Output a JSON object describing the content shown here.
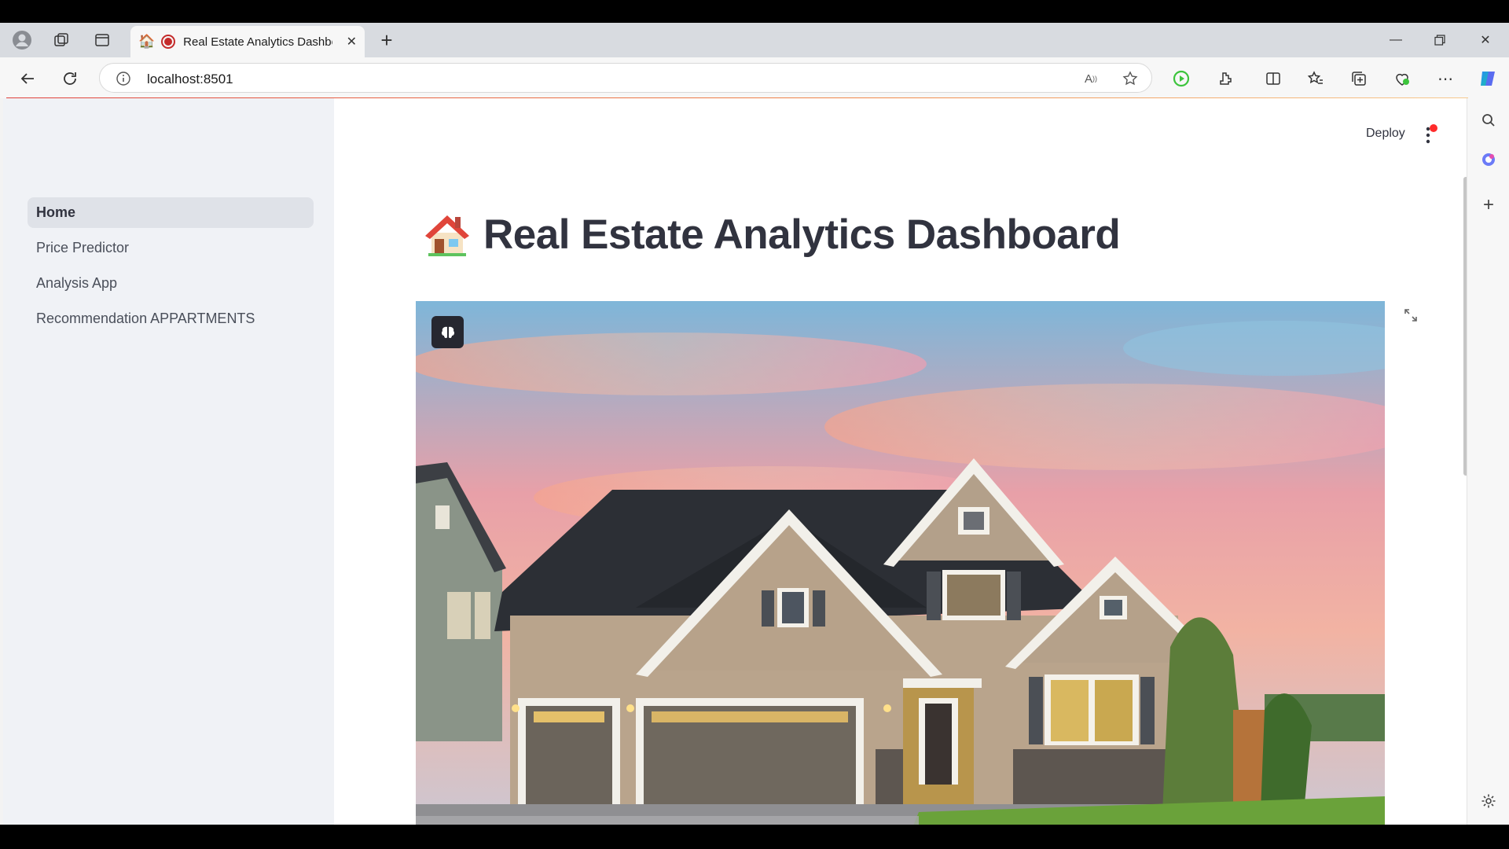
{
  "browser": {
    "tab_title": "Real Estate Analytics Dashbo",
    "url": "localhost:8501"
  },
  "sidebar": {
    "items": [
      {
        "label": "Home",
        "active": true
      },
      {
        "label": "Price Predictor",
        "active": false
      },
      {
        "label": "Analysis App",
        "active": false
      },
      {
        "label": "Recommendation APPARTMENTS",
        "active": false
      }
    ]
  },
  "header": {
    "deploy_label": "Deploy"
  },
  "main": {
    "title": "Real Estate Analytics Dashboard"
  },
  "colors": {
    "sidebar_bg": "#f0f2f6",
    "text": "#31333f",
    "accent_red": "#ff4b4b"
  }
}
